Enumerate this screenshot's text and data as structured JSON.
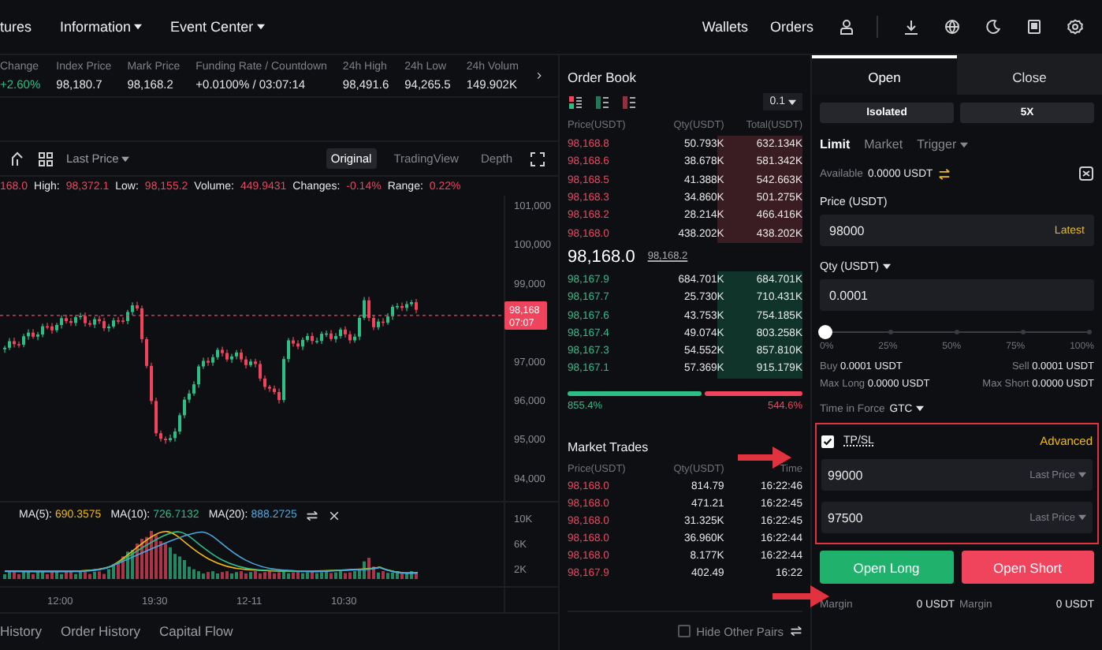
{
  "nav": {
    "items": [
      {
        "label": "tures",
        "dropdown": false
      },
      {
        "label": "Information",
        "dropdown": true
      },
      {
        "label": "Event Center",
        "dropdown": true
      }
    ],
    "links": [
      "Wallets",
      "Orders"
    ]
  },
  "ticker": [
    {
      "label": "Change",
      "value": "+2.60%",
      "color": "#2ebd85"
    },
    {
      "label": "Index Price",
      "value": "98,180.7",
      "color": "#e6e6e6"
    },
    {
      "label": "Mark Price",
      "value": "98,168.2",
      "color": "#e6e6e6"
    },
    {
      "label": "Funding Rate / Countdown",
      "value": "+0.0100% / 03:07:14",
      "color": "#e6e6e6"
    },
    {
      "label": "24h High",
      "value": "98,491.6",
      "color": "#e6e6e6"
    },
    {
      "label": "24h Low",
      "value": "94,265.5",
      "color": "#e6e6e6"
    },
    {
      "label": "24h Volum",
      "value": "149.902K",
      "color": "#e6e6e6"
    }
  ],
  "chart": {
    "price_type": "Last Price",
    "views": [
      {
        "label": "Original",
        "selected": true
      },
      {
        "label": "TradingView",
        "selected": false
      },
      {
        "label": "Depth",
        "selected": false
      }
    ],
    "close_fragment": "168.0",
    "stats": [
      {
        "label": "High:",
        "value": "98,372.1"
      },
      {
        "label": "Low:",
        "value": "98,155.2"
      },
      {
        "label": "Volume:",
        "value": "449.9431"
      },
      {
        "label": "Changes:",
        "value": "-0.14%"
      },
      {
        "label": "Range:",
        "value": "0.22%"
      }
    ],
    "price_axis": [
      "101,000",
      "100,000",
      "99,000",
      "97,000",
      "96,000",
      "95,000",
      "94,000"
    ],
    "price_tag": {
      "price": "98,168",
      "countdown": "07:07"
    },
    "indicators": [
      {
        "label": "MA(5):",
        "value": "690.3575",
        "color": "#f0b90b"
      },
      {
        "label": "MA(10):",
        "value": "726.7132",
        "color": "#2ebd85"
      },
      {
        "label": "MA(20):",
        "value": "888.2725",
        "color": "#4aa8e0"
      }
    ],
    "volume_axis": [
      "10K",
      "6K",
      "2K"
    ],
    "time_axis": [
      "12:00",
      "19:30",
      "12-11",
      "10:30"
    ]
  },
  "bottom_tabs": [
    {
      "label": "History",
      "selected": false
    },
    {
      "label": "Order History",
      "selected": false
    },
    {
      "label": "Capital Flow",
      "selected": false
    }
  ],
  "order_book": {
    "title": "Order Book",
    "precision": "0.1",
    "columns": [
      "Price(USDT)",
      "Qty(USDT)",
      "Total(USDT)"
    ],
    "asks": [
      {
        "price": "98,168.8",
        "qty": "50.793K",
        "total": "632.134K"
      },
      {
        "price": "98,168.6",
        "qty": "38.678K",
        "total": "581.342K"
      },
      {
        "price": "98,168.5",
        "qty": "41.388K",
        "total": "542.663K"
      },
      {
        "price": "98,168.3",
        "qty": "34.860K",
        "total": "501.275K"
      },
      {
        "price": "98,168.2",
        "qty": "28.214K",
        "total": "466.416K"
      },
      {
        "price": "98,168.0",
        "qty": "438.202K",
        "total": "438.202K"
      }
    ],
    "last_price": "98,168.0",
    "mark_price": "98,168.2",
    "bids": [
      {
        "price": "98,167.9",
        "qty": "684.701K",
        "total": "684.701K"
      },
      {
        "price": "98,167.7",
        "qty": "25.730K",
        "total": "710.431K"
      },
      {
        "price": "98,167.6",
        "qty": "43.753K",
        "total": "754.185K"
      },
      {
        "price": "98,167.4",
        "qty": "49.074K",
        "total": "803.258K"
      },
      {
        "price": "98,167.3",
        "qty": "54.552K",
        "total": "857.810K"
      },
      {
        "price": "98,167.1",
        "qty": "57.369K",
        "total": "915.179K"
      }
    ],
    "ratio": {
      "level": 0.57,
      "buy": "855.4%",
      "sell": "544.6%"
    }
  },
  "market_trades": {
    "title": "Market Trades",
    "columns": [
      "Price(USDT)",
      "Qty(USDT)",
      "Time"
    ],
    "rows": [
      {
        "price": "98,168.0",
        "qty": "814.79",
        "time": "16:22:46",
        "color": "#f0445c"
      },
      {
        "price": "98,168.0",
        "qty": "471.21",
        "time": "16:22:45",
        "color": "#f0445c"
      },
      {
        "price": "98,168.0",
        "qty": "31.325K",
        "time": "16:22:45",
        "color": "#f0445c"
      },
      {
        "price": "98,168.0",
        "qty": "36.960K",
        "time": "16:22:44",
        "color": "#f0445c"
      },
      {
        "price": "98,168.0",
        "qty": "8.177K",
        "time": "16:22:44",
        "color": "#f0445c"
      },
      {
        "price": "98,167.9",
        "qty": "402.49",
        "time": "16:22",
        "color": "#f0445c"
      }
    ],
    "hide_other_pairs": {
      "label": "Hide Other Pairs",
      "checked": false
    }
  },
  "order_form": {
    "tabs": [
      {
        "label": "Open",
        "selected": true
      },
      {
        "label": "Close",
        "selected": false
      }
    ],
    "margin_mode": "Isolated",
    "leverage": "5X",
    "order_types": [
      {
        "label": "Limit",
        "selected": true,
        "dropdown": false
      },
      {
        "label": "Market",
        "selected": false,
        "dropdown": false
      },
      {
        "label": "Trigger",
        "selected": false,
        "dropdown": true
      }
    ],
    "available_label": "Available",
    "available_value": "0.0000 USDT",
    "price": {
      "label": "Price (USDT)",
      "value": "98000",
      "action": "Latest"
    },
    "qty": {
      "label": "Qty (USDT)",
      "value": "0.0001"
    },
    "slider": {
      "level": 0,
      "ticks": [
        "0%",
        "25%",
        "50%",
        "75%",
        "100%"
      ]
    },
    "summary": [
      {
        "label": "Buy",
        "value": "0.0001 USDT"
      },
      {
        "label": "Sell",
        "value": "0.0001 USDT"
      },
      {
        "label": "Max Long",
        "value": "0.0000 USDT"
      },
      {
        "label": "Max Short",
        "value": "0.0000 USDT"
      }
    ],
    "time_in_force": {
      "label": "Time in Force",
      "value": "GTC"
    },
    "tpsl": {
      "label": "TP/SL",
      "checked": true,
      "advanced": "Advanced",
      "fields": [
        {
          "value": "99000",
          "trigger": "Last Price"
        },
        {
          "value": "97500",
          "trigger": "Last Price"
        }
      ]
    },
    "buttons": [
      {
        "label": "Open Long",
        "kind": "long"
      },
      {
        "label": "Open Short",
        "kind": "short"
      }
    ],
    "margins": [
      {
        "label": "Margin",
        "value": "0 USDT"
      },
      {
        "label": "Margin",
        "value": "0 USDT"
      }
    ]
  }
}
